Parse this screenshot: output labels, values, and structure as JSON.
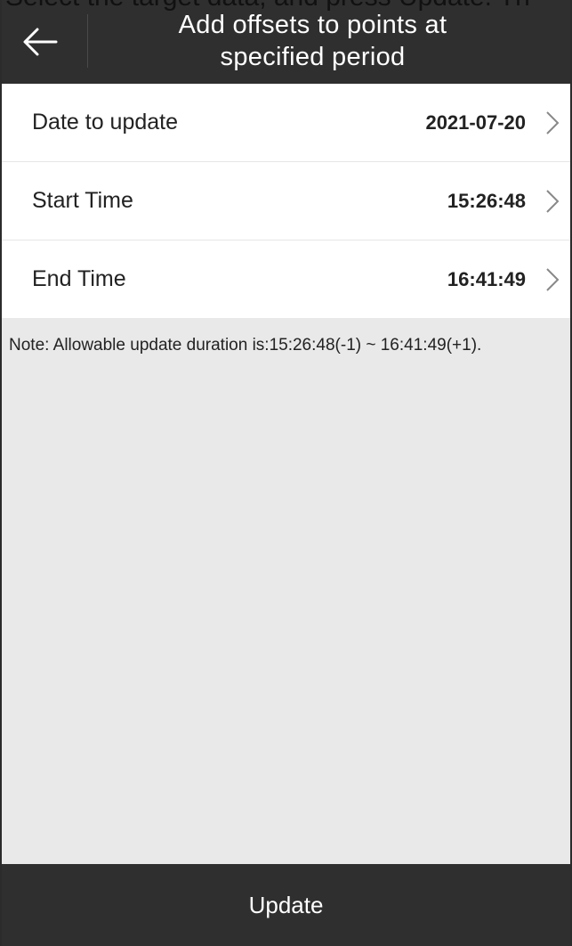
{
  "caption_fragment": "Select the target data, and press Update. Th",
  "header": {
    "back_icon": "arrow-left-icon",
    "title_line1": "Add offsets to points at",
    "title_line2": "specified period"
  },
  "rows": [
    {
      "label": "Date to update",
      "value": "2021-07-20",
      "icon": "chevron-right-icon"
    },
    {
      "label": "Start Time",
      "value": "15:26:48",
      "icon": "chevron-right-icon"
    },
    {
      "label": "End Time",
      "value": "16:41:49",
      "icon": "chevron-right-icon"
    }
  ],
  "note": "Note: Allowable update duration is:15:26:48(-1) ~ 16:41:49(+1).",
  "footer": {
    "update_label": "Update"
  },
  "colors": {
    "bar_background": "#2f2f2f",
    "content_background": "#e9e9e9",
    "row_background": "#ffffff"
  }
}
